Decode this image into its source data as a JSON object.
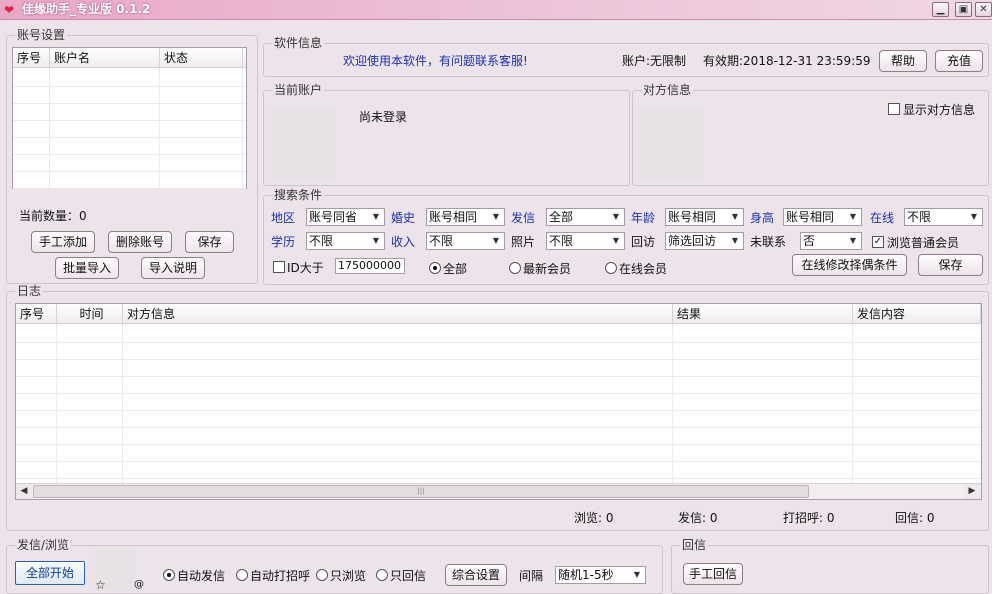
{
  "window": {
    "title": "佳缘助手_专业版 0.1.2",
    "controls": {
      "minimize": "▁",
      "maximize": "▣",
      "close": "✕"
    }
  },
  "account_settings": {
    "title": "账号设置",
    "columns": [
      "序号",
      "账户名",
      "状态"
    ],
    "count_label": "当前数量：0",
    "buttons": {
      "manual_add": "手工添加",
      "delete": "删除账号",
      "save": "保存",
      "batch_import": "批量导入",
      "import_help": "导入说明"
    }
  },
  "software_info": {
    "title": "软件信息",
    "welcome": "欢迎使用本软件，有问题联系客服!",
    "account": "账户:无限制",
    "expiry": "有效期:2018-12-31 23:59:59",
    "help_button": "帮助",
    "recharge_button": "充值"
  },
  "current_account": {
    "title": "当前账户",
    "status": "尚未登录"
  },
  "other_info": {
    "title": "对方信息",
    "show_label": "显示对方信息",
    "show_checked": false
  },
  "search": {
    "title": "搜索条件",
    "row1": {
      "region": {
        "label": "地区",
        "value": "账号同省"
      },
      "marriage": {
        "label": "婚史",
        "value": "账号相同"
      },
      "sent": {
        "label": "发信",
        "value": "全部"
      },
      "age": {
        "label": "年龄",
        "value": "账号相同"
      },
      "height": {
        "label": "身高",
        "value": "账号相同"
      },
      "online": {
        "label": "在线",
        "value": "不限"
      }
    },
    "row2": {
      "education": {
        "label": "学历",
        "value": "不限"
      },
      "income": {
        "label": "收入",
        "value": "不限"
      },
      "photo": {
        "label": "照片",
        "value": "不限"
      },
      "revisit": {
        "label": "回访",
        "value": "筛选回访"
      },
      "uncontacted": {
        "label": "未联系",
        "value": "否"
      },
      "browse_normal": {
        "label": "浏览普通会员",
        "checked": true
      }
    },
    "row3": {
      "id_label": "ID大于",
      "id_checked": false,
      "id_value": "175000000",
      "radios": [
        "全部",
        "最新会员",
        "在线会员"
      ],
      "selected_radio": 0,
      "modify_button": "在线修改择偶条件",
      "save_button": "保存"
    }
  },
  "log": {
    "title": "日志",
    "columns": [
      "序号",
      "时间",
      "对方信息",
      "结果",
      "发信内容"
    ]
  },
  "stats": {
    "browse": "浏览: 0",
    "sent": "发信: 0",
    "greet": "打招呼: 0",
    "reply": "回信: 0"
  },
  "send_browse": {
    "title": "发信/浏览",
    "start_button": "全部开始",
    "star": "☆",
    "at": "@",
    "modes": [
      "自动发信",
      "自动打招呼",
      "只浏览",
      "只回信"
    ],
    "selected_mode": 0,
    "settings_button": "综合设置",
    "interval_label": "间隔",
    "interval_value": "随机1-5秒"
  },
  "reply": {
    "title": "回信",
    "manual_button": "手工回信"
  }
}
